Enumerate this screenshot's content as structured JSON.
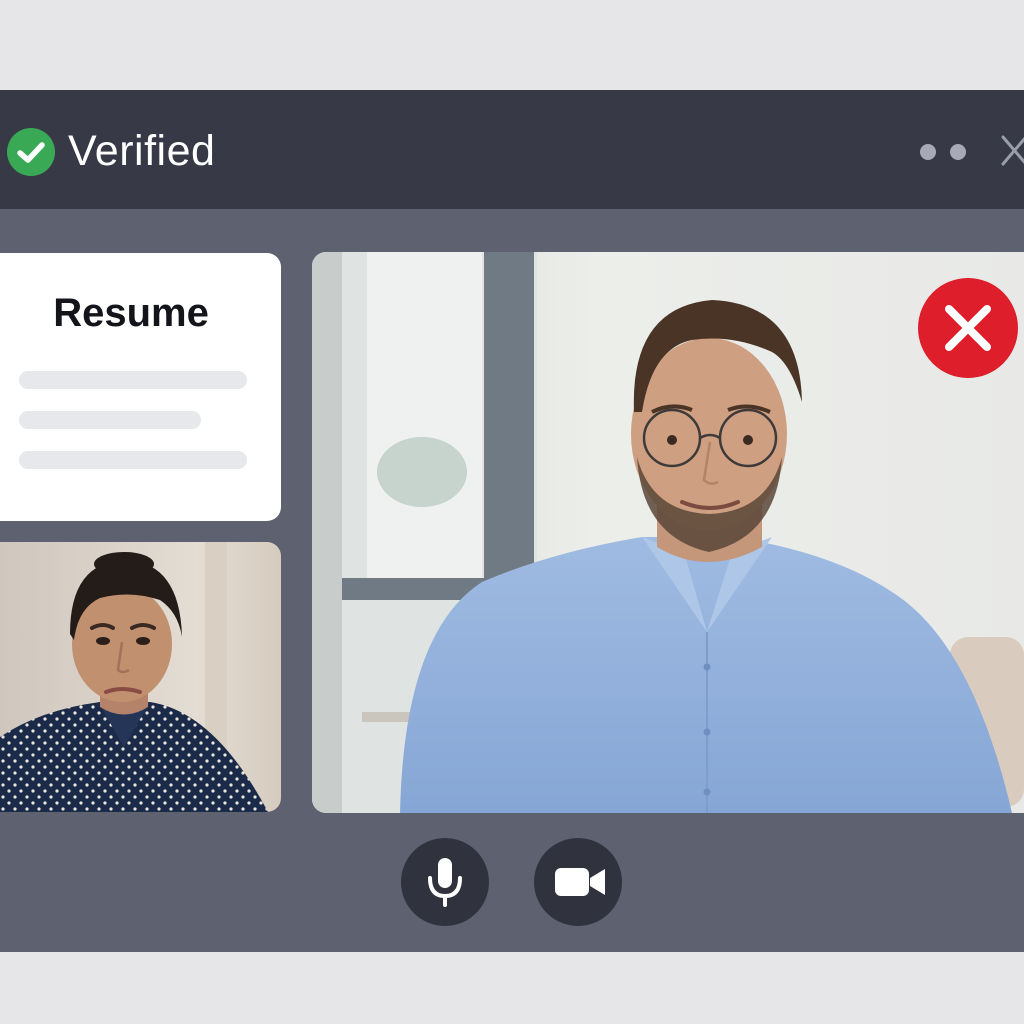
{
  "header": {
    "title": "Verified",
    "status_icon": "check-circle-icon",
    "status_color": "#3aa956"
  },
  "resume": {
    "title": "Resume"
  },
  "participants": {
    "main": {
      "icon_overlay": "reject-x-icon",
      "overlay_color": "#de1f2b"
    },
    "self": {}
  },
  "controls": {
    "mic_icon": "microphone-icon",
    "camera_icon": "video-camera-icon"
  },
  "colors": {
    "titlebar": "#373a46",
    "window": "#5d6170",
    "control_button": "#30333d"
  }
}
